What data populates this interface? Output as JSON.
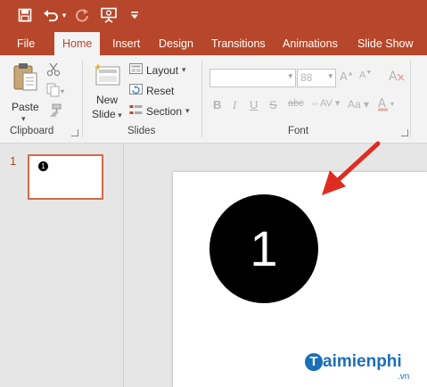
{
  "tabs": [
    {
      "label": "File"
    },
    {
      "label": "Home"
    },
    {
      "label": "Insert"
    },
    {
      "label": "Design"
    },
    {
      "label": "Transitions"
    },
    {
      "label": "Animations"
    },
    {
      "label": "Slide Show"
    }
  ],
  "ribbon": {
    "clipboard": {
      "paste_label": "Paste",
      "group_label": "Clipboard"
    },
    "slides": {
      "new_slide_label_1": "New",
      "new_slide_label_2": "Slide",
      "layout_label": "Layout",
      "reset_label": "Reset",
      "section_label": "Section",
      "group_label": "Slides"
    },
    "font": {
      "font_size_value": "88",
      "group_label": "Font"
    }
  },
  "thumbnails": [
    {
      "number": "1",
      "badge": "1"
    }
  ],
  "slide": {
    "circle_text": "1"
  },
  "watermark": {
    "initial": "T",
    "text": "aimienphi",
    "suffix": ".vn"
  },
  "colors": {
    "accent": "#b7472a",
    "arrow": "#e02b20",
    "circle": "#000000"
  },
  "icons": [
    "save-icon",
    "undo-icon",
    "redo-icon",
    "present-icon",
    "customize-icon",
    "paste-icon",
    "cut-icon",
    "copy-icon",
    "format-painter-icon",
    "new-slide-icon",
    "layout-icon",
    "reset-icon",
    "section-icon",
    "arrow-icon"
  ]
}
